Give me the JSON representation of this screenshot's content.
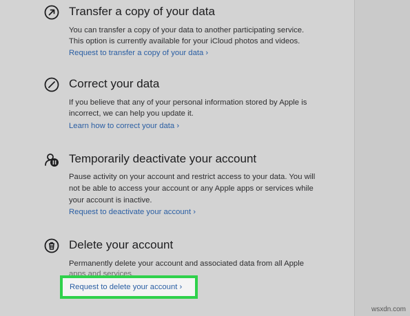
{
  "sections": [
    {
      "icon": "transfer-arrow-icon",
      "title": "Transfer a copy of your data",
      "lines": [
        "You can transfer a copy of your data to another participating service.",
        "This option is currently available for your iCloud photos and videos."
      ],
      "link": "Request to transfer a copy of your data ›"
    },
    {
      "icon": "edit-slash-icon",
      "title": "Correct your data",
      "lines": [
        "If you believe that any of your personal information stored by Apple is",
        "incorrect, we can help you update it."
      ],
      "link": "Learn how to correct your data ›"
    },
    {
      "icon": "account-pause-icon",
      "title": "Temporarily deactivate your account",
      "lines": [
        "Pause activity on your account and restrict access to your data. You will",
        "not be able to access your account or any Apple apps or services while",
        "your account is inactive."
      ],
      "link": "Request to deactivate your account ›"
    },
    {
      "icon": "trash-icon",
      "title": "Delete your account",
      "lines": [
        "Permanently delete your account and associated data from all Apple",
        "apps and services."
      ],
      "link": "Request to delete your account ›"
    }
  ],
  "highlight_color": "#2fd14b",
  "link_color": "#2a5ea3",
  "watermark": "wsxdn.com"
}
